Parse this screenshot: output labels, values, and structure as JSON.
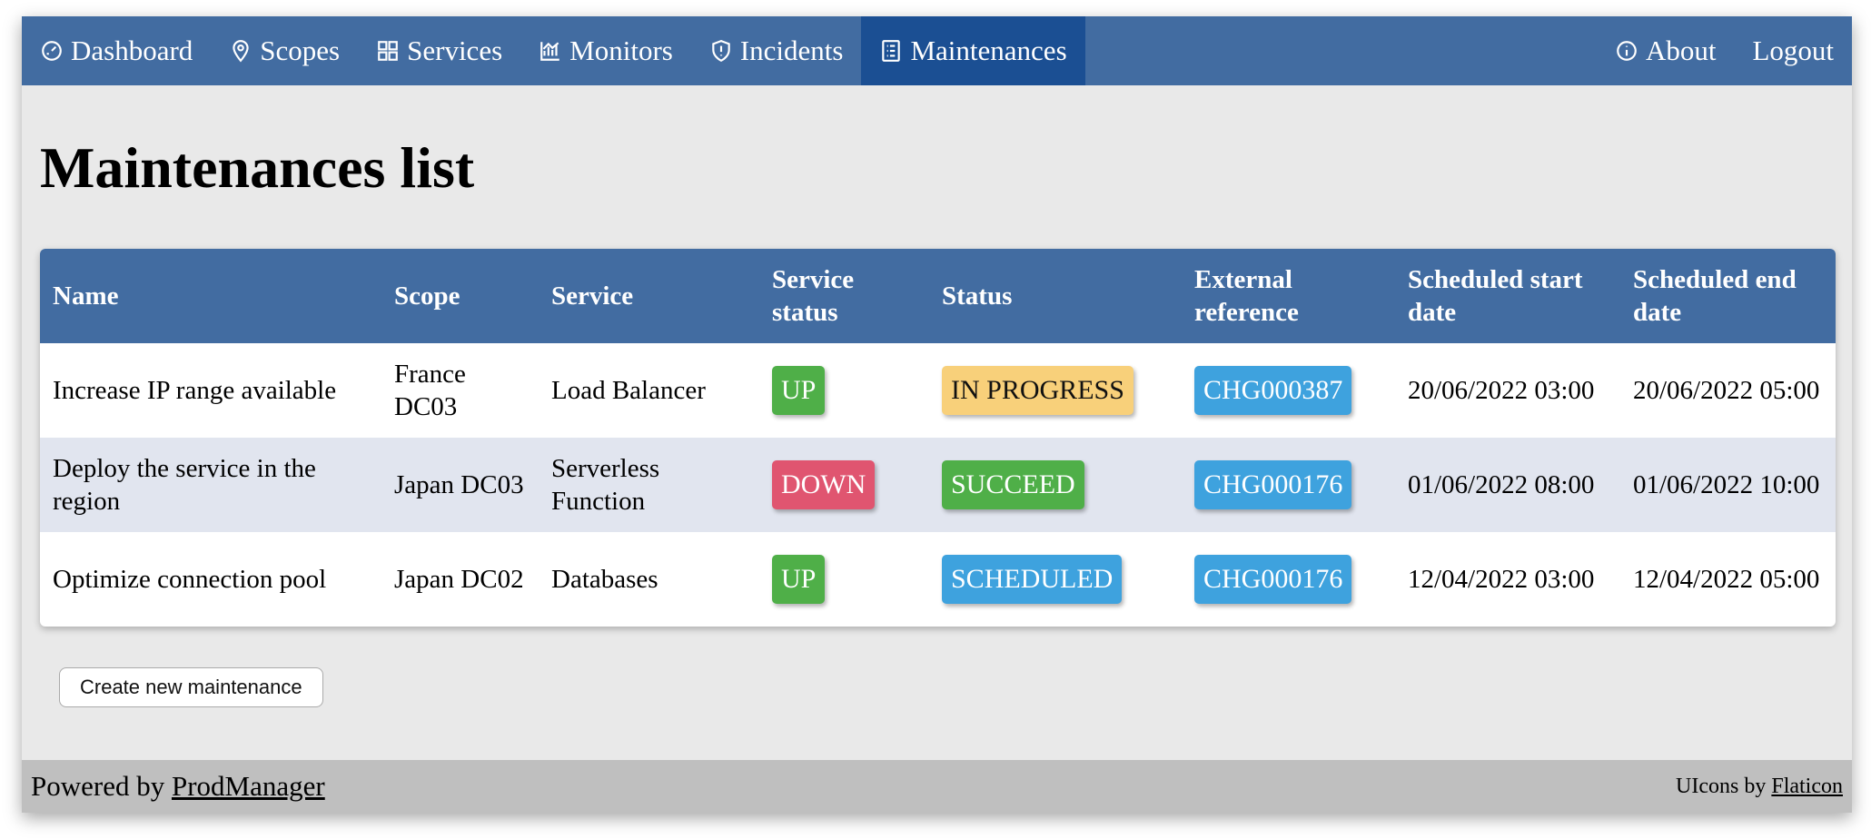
{
  "nav": {
    "left": [
      {
        "label": "Dashboard",
        "icon": "dashboard-icon",
        "active": false
      },
      {
        "label": "Scopes",
        "icon": "location-pin-icon",
        "active": false
      },
      {
        "label": "Services",
        "icon": "grid-icon",
        "active": false
      },
      {
        "label": "Monitors",
        "icon": "chart-icon",
        "active": false
      },
      {
        "label": "Incidents",
        "icon": "shield-icon",
        "active": false
      },
      {
        "label": "Maintenances",
        "icon": "list-icon",
        "active": true
      }
    ],
    "right": [
      {
        "label": "About",
        "icon": "info-icon"
      },
      {
        "label": "Logout"
      }
    ]
  },
  "page": {
    "title": "Maintenances list"
  },
  "table": {
    "headers": [
      "Name",
      "Scope",
      "Service",
      "Service status",
      "Status",
      "External reference",
      "Scheduled start date",
      "Scheduled end date"
    ],
    "rows": [
      {
        "name": "Increase IP range available",
        "scope": "France DC03",
        "service": "Load Balancer",
        "service_status": "UP",
        "status": "IN PROGRESS",
        "reference": "CHG000387",
        "start": "20/06/2022 03:00",
        "end": "20/06/2022 05:00"
      },
      {
        "name": "Deploy the service in the region",
        "scope": "Japan DC03",
        "service": "Serverless Function",
        "service_status": "DOWN",
        "status": "SUCCEED",
        "reference": "CHG000176",
        "start": "01/06/2022 08:00",
        "end": "01/06/2022 10:00"
      },
      {
        "name": "Optimize connection pool",
        "scope": "Japan DC02",
        "service": "Databases",
        "service_status": "UP",
        "status": "SCHEDULED",
        "reference": "CHG000176",
        "start": "12/04/2022 03:00",
        "end": "12/04/2022 05:00"
      }
    ]
  },
  "actions": {
    "create_label": "Create new maintenance"
  },
  "footer": {
    "powered_prefix": "Powered by ",
    "powered_link": "ProdManager",
    "icons_prefix": "UIcons by ",
    "icons_link": "Flaticon"
  },
  "colors": {
    "navbar": "#426ca1",
    "nav_active": "#1b4f93",
    "up": "#4faf48",
    "down": "#e05570",
    "in_progress": "#f8d07a",
    "scheduled": "#3ea2de",
    "row_alt": "#e1e5ef"
  }
}
